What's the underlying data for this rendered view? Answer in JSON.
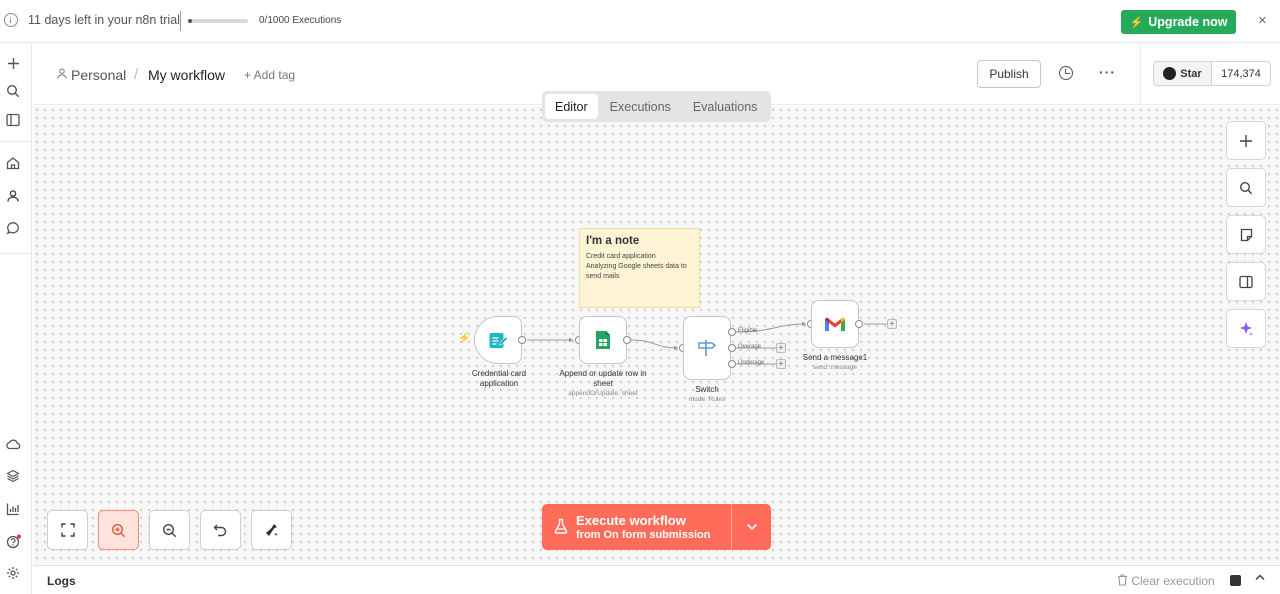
{
  "banner": {
    "trial_text": "11 days left in your n8n trial",
    "executions_text": "0/1000 Executions",
    "executions_used_fraction": 0.0,
    "upgrade_label": "Upgrade now",
    "close_glyph": "×"
  },
  "header": {
    "project": "Personal",
    "separator": "/",
    "workflow_name": "My workflow",
    "add_tag": "+ Add tag",
    "publish_label": "Publish",
    "more_glyph": "···"
  },
  "github": {
    "star_label": "Star",
    "star_count": "174,374"
  },
  "tabs": [
    {
      "label": "Editor",
      "active": true
    },
    {
      "label": "Executions",
      "active": false
    },
    {
      "label": "Evaluations",
      "active": false
    }
  ],
  "note": {
    "title": "I'm a note",
    "lines": [
      "Credit card application",
      "Analyzing Google sheets data to send mails"
    ]
  },
  "nodes": {
    "trigger": {
      "label_line1": "Credential card",
      "label_line2": "application"
    },
    "sheets": {
      "label_line1": "Append or update row in",
      "label_line2": "sheet",
      "subtitle": "appendOrUpdate: sheet"
    },
    "switch": {
      "label": "Switch",
      "subtitle": "mode: Rules",
      "outputs": [
        "Eligible",
        "Overage",
        "Underage"
      ]
    },
    "gmail": {
      "label": "Send a message1",
      "subtitle": "send: message"
    }
  },
  "execute": {
    "title": "Execute workflow",
    "subtitle": "from On form submission",
    "chevron": "⌄"
  },
  "logs": {
    "title": "Logs",
    "clear_label": "Clear execution"
  },
  "colors": {
    "accent": "#ff6d5a",
    "upgrade": "#27a95a",
    "note_bg": "#fff3d6"
  }
}
